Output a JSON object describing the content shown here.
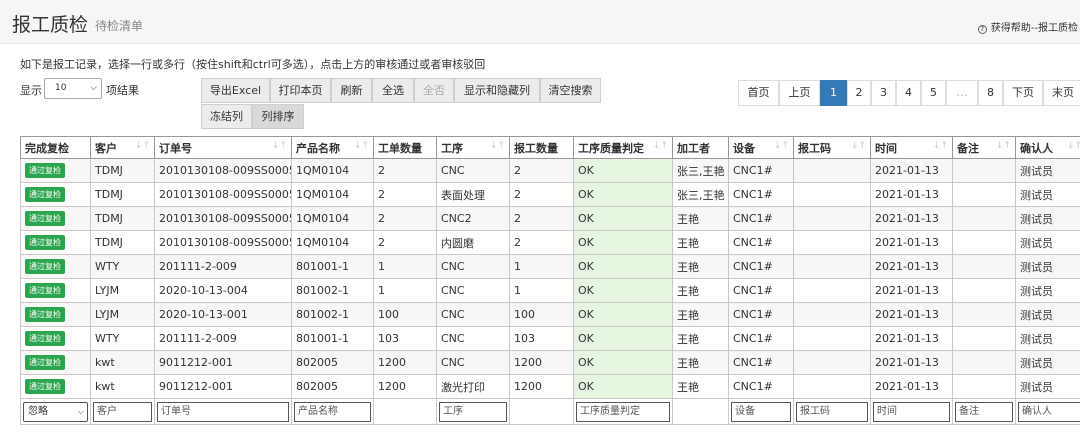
{
  "header": {
    "title": "报工质检",
    "subtitle": "待检清单",
    "help_icon": "?",
    "help_text": "获得帮助--报工质检"
  },
  "intro": "如下是报工记录，选择一行或多行（按住shift和ctrl可多选），点击上方的审核通过或者审核驳回",
  "length": {
    "label": "显示",
    "value": "10",
    "suffix": "项结果"
  },
  "toolbar": {
    "export": "导出Excel",
    "print": "打印本页",
    "refresh": "刷新",
    "select_all": "全选",
    "select_none": "全否",
    "toggle_cols": "显示和隐藏列",
    "clear_search": "清空搜索",
    "freeze_cols": "冻结列",
    "sort_cols": "列排序"
  },
  "pagination": {
    "first": "首页",
    "prev": "上页",
    "pages": [
      "1",
      "2",
      "3",
      "4",
      "5"
    ],
    "ellipsis": "…",
    "last_page": "8",
    "next": "下页",
    "last": "末页"
  },
  "table": {
    "headers": [
      "完成复检",
      "客户",
      "订单号",
      "产品名称",
      "工单数量",
      "工序",
      "报工数量",
      "工序质量判定",
      "加工者",
      "设备",
      "报工码",
      "时间",
      "备注",
      "确认人"
    ],
    "badge_label": "通过复检",
    "rows": [
      [
        "TDMJ",
        "2010130108-009SS0005",
        "1QM0104",
        "2",
        "CNC",
        "2",
        "OK",
        "张三,王艳",
        "CNC1#",
        "",
        "2021-01-13",
        "",
        "测试员"
      ],
      [
        "TDMJ",
        "2010130108-009SS0005",
        "1QM0104",
        "2",
        "表面处理",
        "2",
        "OK",
        "张三,王艳",
        "CNC1#",
        "",
        "2021-01-13",
        "",
        "测试员"
      ],
      [
        "TDMJ",
        "2010130108-009SS0005",
        "1QM0104",
        "2",
        "CNC2",
        "2",
        "OK",
        "王艳",
        "CNC1#",
        "",
        "2021-01-13",
        "",
        "测试员"
      ],
      [
        "TDMJ",
        "2010130108-009SS0005",
        "1QM0104",
        "2",
        "内圆磨",
        "2",
        "OK",
        "王艳",
        "CNC1#",
        "",
        "2021-01-13",
        "",
        "测试员"
      ],
      [
        "WTY",
        "201111-2-009",
        "801001-1",
        "1",
        "CNC",
        "1",
        "OK",
        "王艳",
        "CNC1#",
        "",
        "2021-01-13",
        "",
        "测试员"
      ],
      [
        "LYJM",
        "2020-10-13-004",
        "801002-1",
        "1",
        "CNC",
        "1",
        "OK",
        "王艳",
        "CNC1#",
        "",
        "2021-01-13",
        "",
        "测试员"
      ],
      [
        "LYJM",
        "2020-10-13-001",
        "801002-1",
        "100",
        "CNC",
        "100",
        "OK",
        "王艳",
        "CNC1#",
        "",
        "2021-01-13",
        "",
        "测试员"
      ],
      [
        "WTY",
        "201111-2-009",
        "801001-1",
        "103",
        "CNC",
        "103",
        "OK",
        "王艳",
        "CNC1#",
        "",
        "2021-01-13",
        "",
        "测试员"
      ],
      [
        "kwt",
        "9011212-001",
        "802005",
        "1200",
        "CNC",
        "1200",
        "OK",
        "王艳",
        "CNC1#",
        "",
        "2021-01-13",
        "",
        "测试员"
      ],
      [
        "kwt",
        "9011212-001",
        "802005",
        "1200",
        "激光打印",
        "1200",
        "OK",
        "王艳",
        "CNC1#",
        "",
        "2021-01-13",
        "",
        "测试员"
      ]
    ],
    "filters": {
      "status": "忽略",
      "customer": "客户",
      "order": "订单号",
      "product": "产品名称",
      "process": "工序",
      "quality": "工序质量判定",
      "equipment": "设备",
      "report_code": "报工码",
      "time": "时间",
      "remark": "备注",
      "confirmer": "确认人"
    }
  },
  "colors": {
    "primary": "#337ab7",
    "badge": "#2da44e",
    "ok_cell": "#e6f5e0"
  }
}
